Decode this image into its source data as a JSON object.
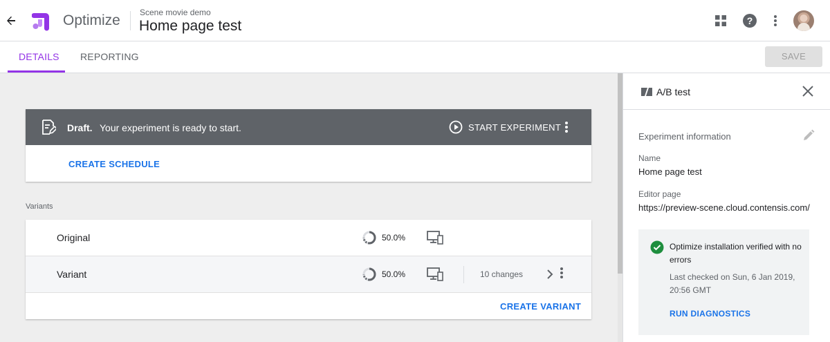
{
  "header": {
    "product_name": "Optimize",
    "container_name": "Scene movie demo",
    "experience_title": "Home page test"
  },
  "tabs": [
    {
      "label": "DETAILS",
      "active": true
    },
    {
      "label": "REPORTING",
      "active": false
    }
  ],
  "toolbar": {
    "save_label": "SAVE"
  },
  "draft": {
    "label": "Draft.",
    "message": "Your experiment is ready to start.",
    "start_label": "START EXPERIMENT",
    "create_schedule_label": "CREATE SCHEDULE"
  },
  "variants": {
    "heading": "Variants",
    "items": [
      {
        "name": "Original",
        "weight": "50.0%",
        "changes": ""
      },
      {
        "name": "Variant",
        "weight": "50.0%",
        "changes": "10 changes"
      }
    ],
    "create_variant_label": "CREATE VARIANT"
  },
  "panel": {
    "title": "A/B test",
    "info_heading": "Experiment information",
    "name_label": "Name",
    "name_value": "Home page test",
    "editor_label": "Editor page",
    "editor_value": "https://preview-scene.cloud.contensis.com/",
    "verify_text": "Optimize installation verified with no errors",
    "checked_text": "Last checked on Sun, 6 Jan 2019, 20:56 GMT",
    "run_diagnostics_label": "RUN DIAGNOSTICS"
  },
  "colors": {
    "accent": "#9334e6",
    "link": "#1a73e8",
    "draft_bar": "#5f6368",
    "success": "#1e8e3e"
  }
}
